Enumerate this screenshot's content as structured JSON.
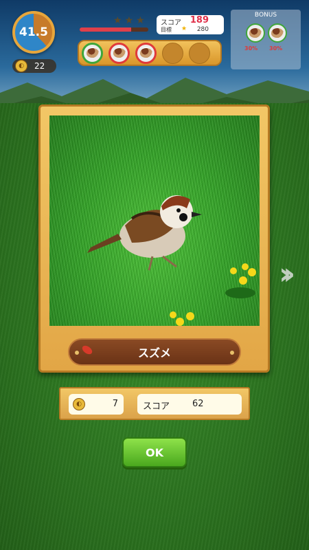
{
  "hud": {
    "timer": "41.5",
    "seeds": "22",
    "score_label": "スコア",
    "score_value": "189",
    "target_label": "目標",
    "target_value": "280",
    "hp_fraction": 0.75,
    "bird_slots": {
      "filled": 3,
      "total": 5
    }
  },
  "bonus": {
    "title": "BONUS",
    "items": [
      {
        "pct": "30%"
      },
      {
        "pct": "30%"
      }
    ]
  },
  "card": {
    "bird_name": "スズメ"
  },
  "result": {
    "seeds": "7",
    "score_label": "スコア",
    "score_value": "62"
  },
  "ok_button": "OK",
  "colors": {
    "accent_red": "#e0304a",
    "ok_green": "#4aa81e",
    "wood": "#e2a646"
  }
}
